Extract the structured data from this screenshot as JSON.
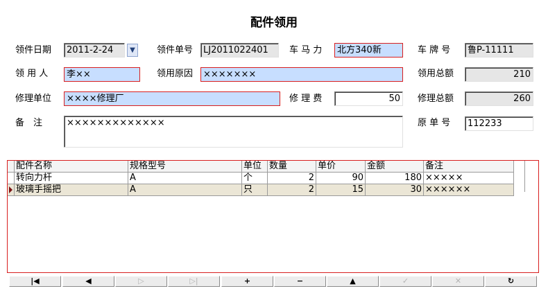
{
  "title": "配件领用",
  "form": {
    "issue_date_label": "领件日期",
    "issue_date_value": "2011-2-24",
    "issue_no_label": "领件单号",
    "issue_no_value": "LJ2011022401",
    "horsepower_label": "车 马 力",
    "horsepower_value": "北方340新",
    "plate_label": "车 牌 号",
    "plate_value": "鲁P-11111",
    "receiver_label": "领 用 人",
    "receiver_value": "李××",
    "reason_label": "领用原因",
    "reason_value": "×××××××",
    "issue_total_label": "领用总额",
    "issue_total_value": "210",
    "repair_unit_label": "修理单位",
    "repair_unit_value": "××××修理厂",
    "repair_fee_label": "修 理 费",
    "repair_fee_value": "50",
    "repair_total_label": "修理总额",
    "repair_total_value": "260",
    "remark_label": "备　注",
    "remark_value": "×××××××××××××",
    "orig_no_label": "原 单 号",
    "orig_no_value": "112233"
  },
  "grid": {
    "columns": [
      "配件名称",
      "规格型号",
      "单位",
      "数量",
      "单价",
      "金额",
      "备注"
    ],
    "rows": [
      {
        "name": "转向力杆",
        "spec": "A",
        "unit": "个",
        "qty": "2",
        "price": "90",
        "amount": "180",
        "note": "×××××"
      },
      {
        "name": "玻璃手摇把",
        "spec": "A",
        "unit": "只",
        "qty": "2",
        "price": "15",
        "amount": "30",
        "note": "××××××"
      }
    ]
  },
  "nav": {
    "first": "|◀",
    "prev": "◀",
    "next": "▷",
    "last": "▷|",
    "add": "+",
    "delete": "−",
    "up": "▲",
    "post": "✓",
    "cancel": "✕",
    "refresh": "↻"
  }
}
